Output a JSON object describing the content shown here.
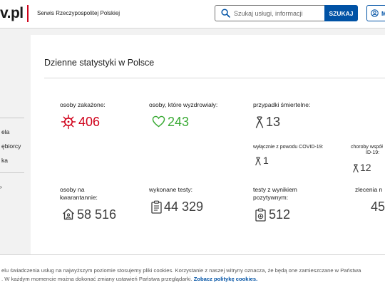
{
  "header": {
    "logo": "v.pl",
    "logo_sub": "Serwis Rzeczypospolitej Polskiej",
    "search_placeholder": "Szukaj usługi, informacji",
    "search_button": "SZUKAJ",
    "login_button": "Mo"
  },
  "sidebar": {
    "items": [
      "ela",
      "ębiorcy",
      "ka"
    ]
  },
  "stats": {
    "title": "Dzienne statystyki w Polsce",
    "infected": {
      "label": "osoby zakażone:",
      "value": "406",
      "color": "#d0021b"
    },
    "recovered": {
      "label": "osoby, które wyzdrowiały:",
      "value": "243",
      "color": "#3aaa35"
    },
    "deaths": {
      "label": "przypadki śmiertelne:",
      "value": "13"
    },
    "deaths_covid": {
      "label": "wyłącznie z powodu COVID-19:",
      "value": "1"
    },
    "deaths_comorb": {
      "label_line1": "choroby współ",
      "label_line2": "ID-19:",
      "value": "12"
    },
    "quarantine": {
      "label_line1": "osoby na",
      "label_line2": "kwarantannie:",
      "value": "58 516"
    },
    "tests": {
      "label": "wykonane testy:",
      "value": "44 329"
    },
    "positive_tests": {
      "label_line1": "testy z wynikiem",
      "label_line2": "pozytywnym:",
      "value": "512"
    },
    "orders": {
      "label": "zlecenia n",
      "value": "45"
    }
  },
  "cookie": {
    "line1": "elu świadczenia usług na najwyższym poziomie stosujemy pliki cookies. Korzystanie z naszej witryny oznacza, że będą one zamieszczane w Państwa",
    "line2": ". W każdym momencie można dokonać zmiany ustawień Państwa przeglądarki.",
    "link": "Zobacz politykę cookies."
  }
}
